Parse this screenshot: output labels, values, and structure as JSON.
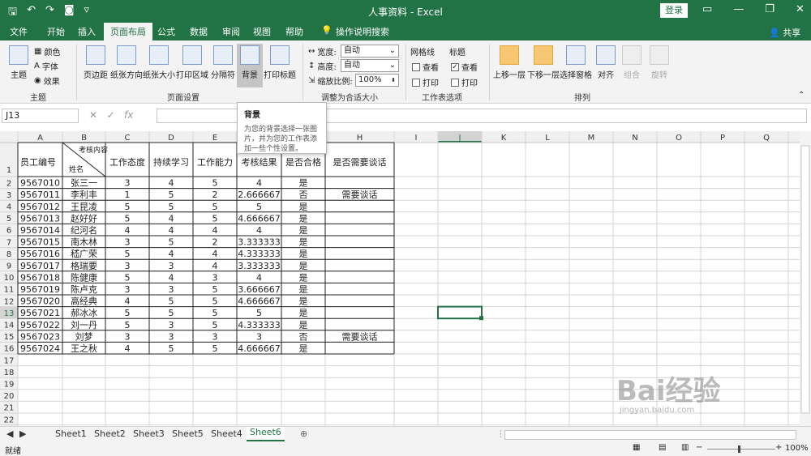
{
  "window": {
    "title": "人事资料 - Excel",
    "login": "登录",
    "share": "共享"
  },
  "tabs": [
    "文件",
    "开始",
    "插入",
    "页面布局",
    "公式",
    "数据",
    "审阅",
    "视图",
    "帮助"
  ],
  "tell_me": "操作说明搜索",
  "ribbon": {
    "theme": "主题",
    "colors": "颜色",
    "fonts": "字体",
    "effects": "效果",
    "margins": "页边距",
    "orientation": "纸张方向",
    "size": "纸张大小",
    "print_area": "打印区域",
    "breaks": "分隔符",
    "background": "背景",
    "print_titles": "打印标题",
    "width_label": "宽度:",
    "width_value": "自动",
    "height_label": "高度:",
    "height_value": "自动",
    "scale_label": "缩放比例:",
    "scale_value": "100%",
    "gridlines": "网格线",
    "headings": "标题",
    "view": "查看",
    "print": "打印",
    "bring_forward": "上移一层",
    "send_backward": "下移一层",
    "selection_pane": "选择窗格",
    "align": "对齐",
    "group": "组合",
    "rotate": "旋转",
    "groups": {
      "themes": "主题",
      "page_setup": "页面设置",
      "scale_to_fit": "调整为合适大小",
      "sheet_options": "工作表选项",
      "arrange": "排列"
    }
  },
  "tooltip": {
    "title": "背景",
    "body": "为您的背景选择一张图片，并为您的工作表添加一些个性设置。"
  },
  "formula_bar": {
    "name_box": "J13",
    "fx": "fx"
  },
  "columns": [
    "A",
    "B",
    "C",
    "D",
    "E",
    "F",
    "G",
    "H",
    "I",
    "J",
    "K",
    "L",
    "M",
    "N",
    "O",
    "P",
    "Q"
  ],
  "header_row": {
    "a": "员工编号",
    "b_top": "考核内容",
    "b_bottom": "姓名",
    "c": "工作态度",
    "d": "持续学习",
    "e": "工作能力",
    "f": "考核结果",
    "g": "是否合格",
    "h": "是否需要谈话"
  },
  "rows": [
    [
      "9567010",
      "张三一",
      "3",
      "4",
      "5",
      "4",
      "是",
      ""
    ],
    [
      "9567011",
      "李利丰",
      "1",
      "5",
      "2",
      "2.666667",
      "否",
      "需要谈话"
    ],
    [
      "9567012",
      "王昆凌",
      "5",
      "5",
      "5",
      "5",
      "是",
      ""
    ],
    [
      "9567013",
      "赵好好",
      "5",
      "4",
      "5",
      "4.666667",
      "是",
      ""
    ],
    [
      "9567014",
      "纪河名",
      "4",
      "4",
      "4",
      "4",
      "是",
      ""
    ],
    [
      "9567015",
      "南木林",
      "3",
      "5",
      "2",
      "3.333333",
      "是",
      ""
    ],
    [
      "9567016",
      "嵇广荣",
      "5",
      "4",
      "4",
      "4.333333",
      "是",
      ""
    ],
    [
      "9567017",
      "格瑞要",
      "3",
      "3",
      "4",
      "3.333333",
      "是",
      ""
    ],
    [
      "9567018",
      "陈健康",
      "5",
      "4",
      "3",
      "4",
      "是",
      ""
    ],
    [
      "9567019",
      "陈卢克",
      "3",
      "3",
      "5",
      "3.666667",
      "是",
      ""
    ],
    [
      "9567020",
      "高经典",
      "4",
      "5",
      "5",
      "4.666667",
      "是",
      ""
    ],
    [
      "9567021",
      "郝冰冰",
      "5",
      "5",
      "5",
      "5",
      "是",
      ""
    ],
    [
      "9567022",
      "刘一丹",
      "5",
      "3",
      "5",
      "4.333333",
      "是",
      ""
    ],
    [
      "9567023",
      "刘梦",
      "3",
      "3",
      "3",
      "3",
      "否",
      "需要谈话"
    ],
    [
      "9567024",
      "王之秋",
      "4",
      "5",
      "5",
      "4.666667",
      "是",
      ""
    ]
  ],
  "row_numbers": [
    "1",
    "2",
    "3",
    "4",
    "5",
    "6",
    "7",
    "8",
    "9",
    "10",
    "11",
    "12",
    "13",
    "14",
    "15",
    "16",
    "17",
    "18",
    "19",
    "20",
    "21",
    "22"
  ],
  "sheets": [
    "Sheet1",
    "Sheet2",
    "Sheet3",
    "Sheet5",
    "Sheet4",
    "Sheet6"
  ],
  "active_sheet": "Sheet6",
  "status": {
    "ready": "就绪",
    "zoom": "100%"
  },
  "watermark": {
    "brand": "Bai经验",
    "url": "jingyan.baidu.com"
  },
  "colors": {
    "excel_green": "#217346",
    "grid": "#d4d4d4",
    "selection": "#217346"
  }
}
